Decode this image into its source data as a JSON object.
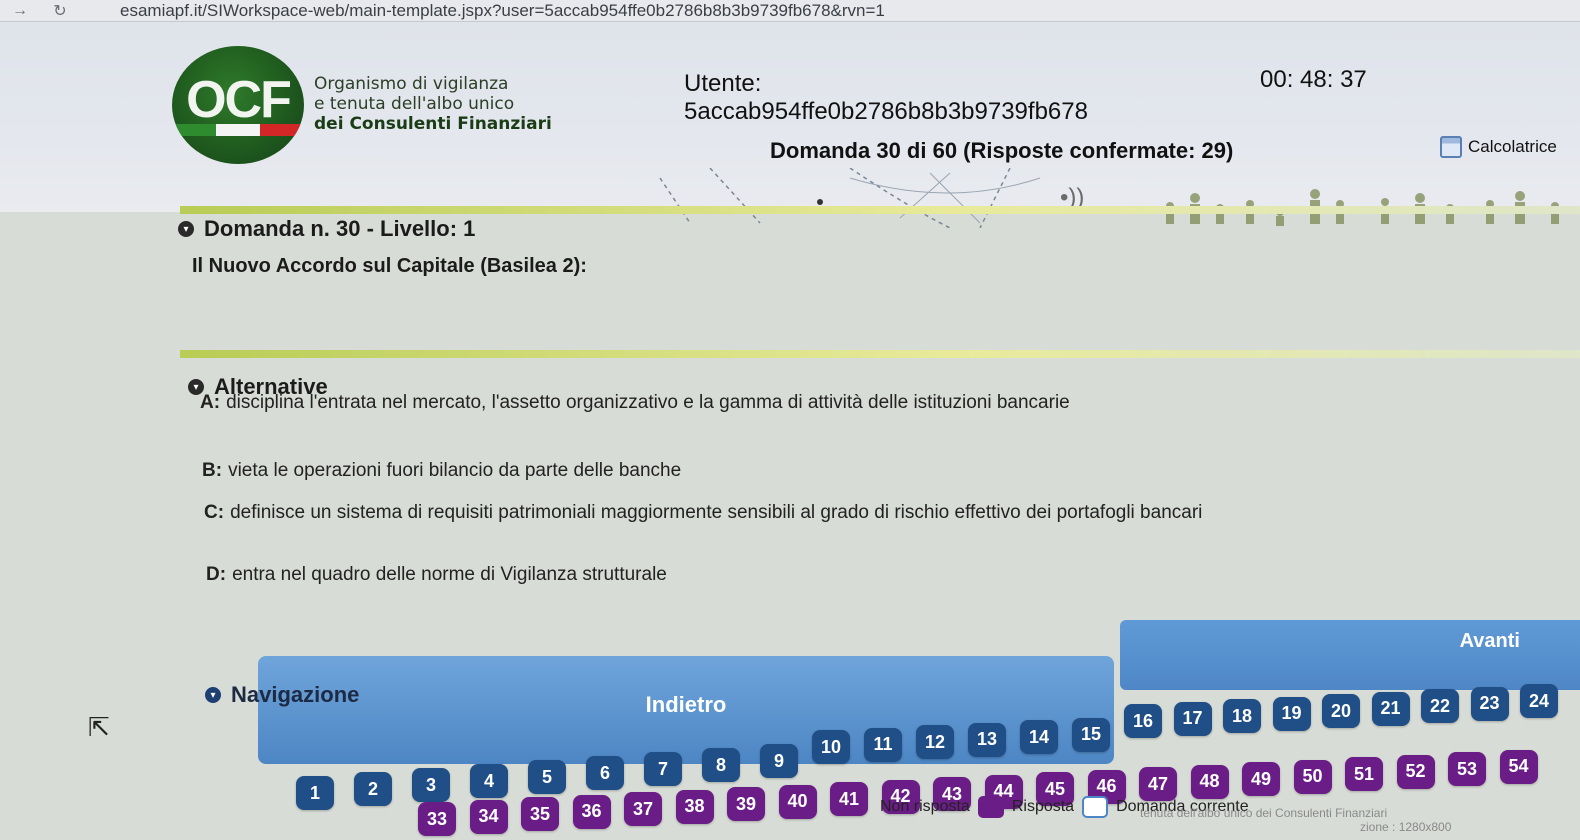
{
  "browser": {
    "url": "esamiapf.it/SIWorkspace-web/main-template.jspx?user=5accab954ffe0b2786b8b3b9739fb678&rvn=1"
  },
  "header": {
    "logo_text": "OCF",
    "org_line1": "Organismo di vigilanza",
    "org_line2": "e tenuta dell'albo unico",
    "org_line3": "dei Consulenti Finanziari",
    "user_label": "Utente:",
    "user_id": "5accab954ffe0b2786b8b3b9739fb678",
    "timer": "00: 48: 37",
    "question_counter": "Domanda 30 di 60 (Risposte confermate: 29)",
    "calculator_label": "Calcolatrice",
    "speaker_glyph": "•))"
  },
  "question": {
    "title": "Domanda n. 30 - Livello: 1",
    "text": "Il Nuovo Accordo sul Capitale (Basilea 2):"
  },
  "alternatives": {
    "title": "Alternative",
    "items": [
      {
        "letter": "A:",
        "text": "disciplina l'entrata nel mercato, l'assetto organizzativo e la gamma di attività delle istituzioni bancarie"
      },
      {
        "letter": "B:",
        "text": "vieta le operazioni fuori bilancio da parte delle banche"
      },
      {
        "letter": "C:",
        "text": "definisce un sistema di requisiti patrimoniali maggiormente sensibili al grado di rischio effettivo dei portafogli bancari"
      },
      {
        "letter": "D:",
        "text": "entra nel quadro delle norme di Vigilanza strutturale"
      }
    ]
  },
  "navigation": {
    "title": "Navigazione",
    "next_label": "Avanti",
    "prev_label": "Indietro",
    "legend": {
      "unanswered": "Non risposta",
      "answered": "Risposta",
      "current": "Domanda corrente"
    },
    "colors": {
      "answered": "#1f4f86",
      "unanswered": "#6a1d86",
      "current": "#ffffff"
    },
    "row_top": [
      "16",
      "17",
      "18",
      "19",
      "20",
      "21",
      "22",
      "23",
      "24"
    ],
    "row_mid_left": [
      "10",
      "11",
      "12",
      "13",
      "14",
      "15"
    ],
    "row_a": [
      "1",
      "2",
      "3",
      "4",
      "5",
      "6",
      "7",
      "8",
      "9"
    ],
    "row_b": [
      "33",
      "34",
      "35",
      "36",
      "37",
      "38",
      "39",
      "40",
      "41",
      "42",
      "43",
      "44",
      "45",
      "46",
      "47",
      "48",
      "49",
      "50",
      "51",
      "52",
      "53",
      "54"
    ]
  },
  "footer": {
    "text": "tenuta dell'albo unico dei Consulenti Finanziari",
    "resolution": "zione : 1280x800"
  }
}
